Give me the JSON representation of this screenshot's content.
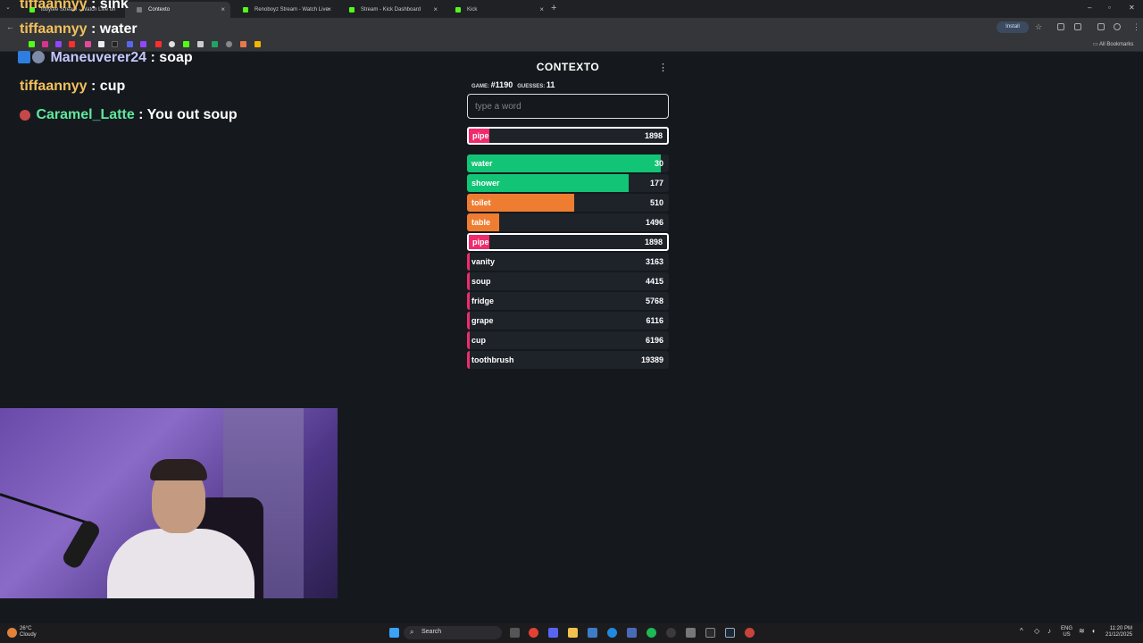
{
  "browser": {
    "tabs": [
      {
        "title": "ibbytee Stream - Watch Live on",
        "active": false
      },
      {
        "title": "Contexto",
        "active": true
      },
      {
        "title": "Renoboyz Stream - Watch Live",
        "active": false
      },
      {
        "title": "Stream - Kick Dashboard",
        "active": false
      },
      {
        "title": "Kick",
        "active": false
      }
    ],
    "install_label": "Install",
    "all_bookmarks_label": "All Bookmarks"
  },
  "chat": {
    "messages": [
      {
        "user": "tiffaannyy",
        "text": " : sink"
      },
      {
        "user": "tiffaannyy",
        "text": " : water"
      },
      {
        "user": "Maneuverer24",
        "text": " : soap"
      },
      {
        "user": "tiffaannyy",
        "text": " : cup"
      },
      {
        "user": "Caramel_Latte",
        "text": " : You out soup"
      }
    ]
  },
  "contexto": {
    "title": "CONTEXTO",
    "game_label": "GAME:",
    "game_number": "#1190",
    "guesses_label": "GUESSES:",
    "guesses_count": "11",
    "input_placeholder": "type a word",
    "last_guess": {
      "word": "pipe",
      "distance": "1898",
      "bar_fraction": 0.1
    },
    "guesses": [
      {
        "word": "water",
        "distance": "30",
        "bar_fraction": 0.96,
        "color": "#12c475"
      },
      {
        "word": "shower",
        "distance": "177",
        "bar_fraction": 0.8,
        "color": "#12c475"
      },
      {
        "word": "toilet",
        "distance": "510",
        "bar_fraction": 0.53,
        "color": "#ef7d31"
      },
      {
        "word": "table",
        "distance": "1496",
        "bar_fraction": 0.16,
        "color": "#ef7d31"
      },
      {
        "word": "pipe",
        "distance": "1898",
        "bar_fraction": 0.1,
        "color": "#f02b6d",
        "highlighted": true
      },
      {
        "word": "vanity",
        "distance": "3163",
        "bar_fraction": 0.01,
        "color": "#f02b6d"
      },
      {
        "word": "soup",
        "distance": "4415",
        "bar_fraction": 0.01,
        "color": "#f02b6d"
      },
      {
        "word": "fridge",
        "distance": "5768",
        "bar_fraction": 0.01,
        "color": "#f02b6d"
      },
      {
        "word": "grape",
        "distance": "6116",
        "bar_fraction": 0.01,
        "color": "#f02b6d"
      },
      {
        "word": "cup",
        "distance": "6196",
        "bar_fraction": 0.01,
        "color": "#f02b6d"
      },
      {
        "word": "toothbrush",
        "distance": "19389",
        "bar_fraction": 0.01,
        "color": "#f02b6d"
      }
    ]
  },
  "taskbar": {
    "search_label": "Search",
    "weather_temp": "26°C",
    "weather_desc": "Cloudy",
    "lang": "ENG",
    "region": "US",
    "time": "11:20 PM",
    "date": "21/12/2025"
  }
}
